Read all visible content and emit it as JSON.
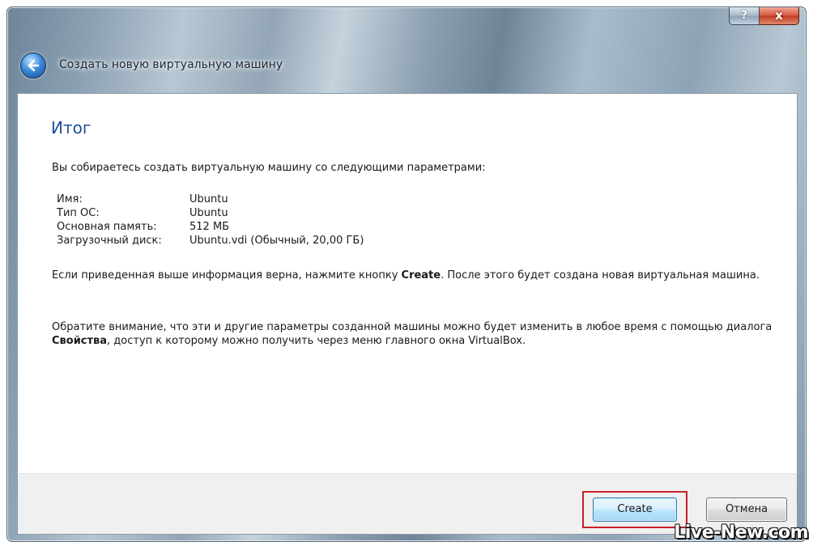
{
  "window": {
    "title": "Создать новую виртуальную машину",
    "help_label": "?",
    "close_label": "x"
  },
  "page": {
    "heading": "Итог",
    "intro": "Вы собираетесь создать виртуальную машину со следующими параметрами:",
    "params": [
      {
        "label": "Имя:",
        "value": "Ubuntu"
      },
      {
        "label": "Тип ОС:",
        "value": "Ubuntu"
      },
      {
        "label": "Основная память:",
        "value": "512 МБ"
      },
      {
        "label": "Загрузочный диск:",
        "value": "Ubuntu.vdi (Обычный, 20,00 ГБ)"
      }
    ],
    "para1": {
      "before": "Если приведенная выше информация верна, нажмите кнопку ",
      "bold": "Create",
      "after": ". После этого будет создана новая виртуальная машина."
    },
    "para2": {
      "before": "Обратите внимание, что эти и другие параметры созданной машины можно будет изменить в любое время с помощью диалога ",
      "bold": "Свойства",
      "after": ", доступ к которому можно получить через меню главного окна VirtualBox."
    }
  },
  "buttons": {
    "create": "Create",
    "cancel": "Отмена"
  },
  "watermark": "Live-New.com",
  "colors": {
    "heading": "#1e4f9a",
    "highlight_border": "#c8202a",
    "close_button": "#c23a22"
  }
}
